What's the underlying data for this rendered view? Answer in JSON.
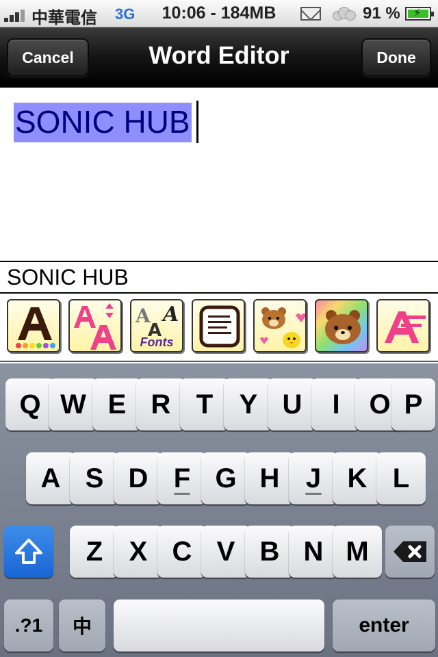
{
  "status_bar": {
    "carrier": "中華電信",
    "network": "3G",
    "time_memory": "10:06 - 184MB",
    "battery_percent": "91 %",
    "icons": [
      "signal-bars-icon",
      "mail-icon",
      "cloud-weather-icon",
      "battery-charging-icon"
    ]
  },
  "nav": {
    "title": "Word Editor",
    "cancel_label": "Cancel",
    "done_label": "Done"
  },
  "editor": {
    "text": "SONIC HUB",
    "selection_color": "#8e8efc",
    "text_color": "#00007e"
  },
  "preview": {
    "text": "SONIC HUB"
  },
  "toolbar": {
    "tools": [
      {
        "icon": "text-color-icon"
      },
      {
        "icon": "text-size-icon"
      },
      {
        "icon": "fonts-icon",
        "label": "Fonts"
      },
      {
        "icon": "notepad-icon"
      },
      {
        "icon": "bear-stickers-icon"
      },
      {
        "icon": "bear-background-icon"
      },
      {
        "icon": "text-effect-icon"
      }
    ]
  },
  "keyboard": {
    "row1": [
      "Q",
      "W",
      "E",
      "R",
      "T",
      "Y",
      "U",
      "I",
      "O",
      "P"
    ],
    "row2": [
      "A",
      "S",
      "D",
      "F",
      "G",
      "H",
      "J",
      "K",
      "L"
    ],
    "row3": [
      "Z",
      "X",
      "C",
      "V",
      "B",
      "N",
      "M"
    ],
    "numbers_label": ".?1",
    "lang_label": "中",
    "enter_label": "enter",
    "accent_color": "#1965d4"
  }
}
